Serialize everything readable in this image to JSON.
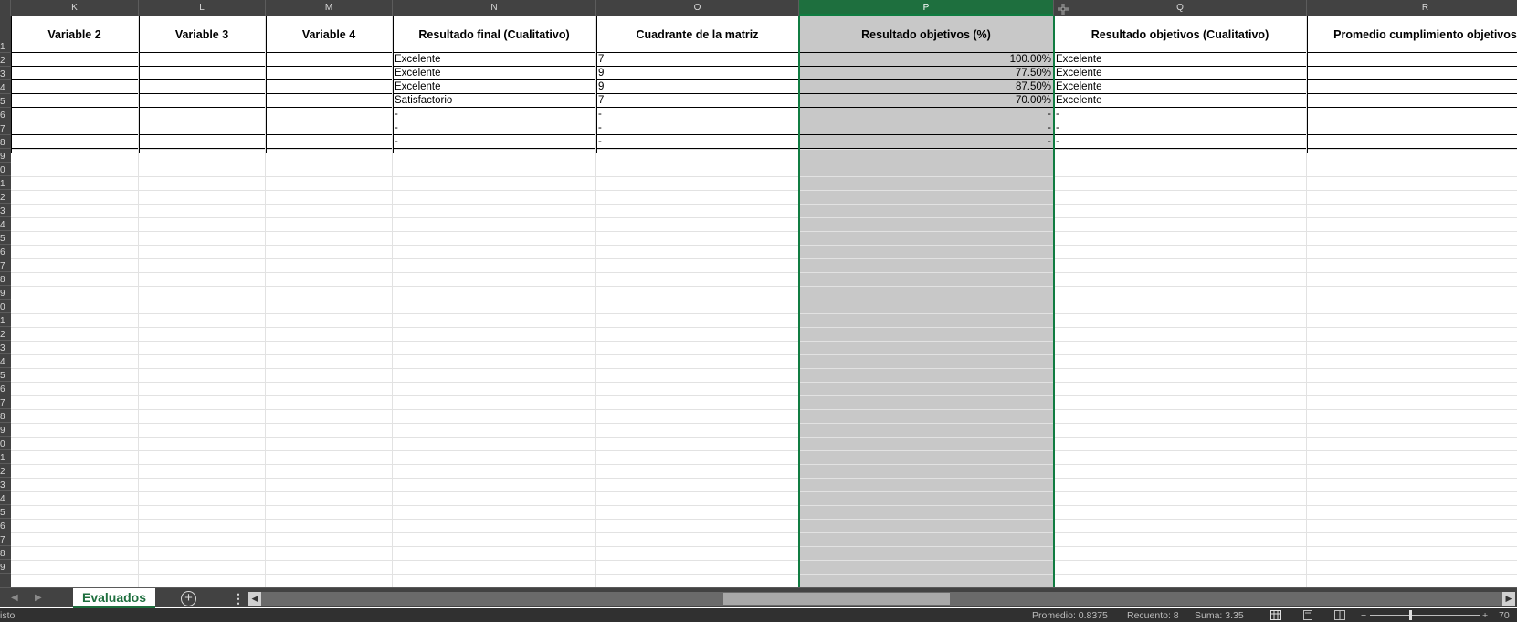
{
  "columns": [
    {
      "letter": "K",
      "header": "Variable 2",
      "selected": false
    },
    {
      "letter": "L",
      "header": "Variable 3",
      "selected": false
    },
    {
      "letter": "M",
      "header": "Variable 4",
      "selected": false
    },
    {
      "letter": "N",
      "header": "Resultado final (Cualitativo)",
      "selected": false
    },
    {
      "letter": "O",
      "header": "Cuadrante de la matriz",
      "selected": false
    },
    {
      "letter": "P",
      "header": "Resultado objetivos (%)",
      "selected": true
    },
    {
      "letter": "Q",
      "header": "Resultado objetivos (Cualitativo)",
      "selected": false
    },
    {
      "letter": "R",
      "header": "Promedio cumplimiento objetivos",
      "selected": false
    }
  ],
  "rows": [
    {
      "N": "Excelente",
      "O": "7",
      "P": "100.00%",
      "Q": "Excelente"
    },
    {
      "N": "Excelente",
      "O": "9",
      "P": "77.50%",
      "Q": "Excelente"
    },
    {
      "N": "Excelente",
      "O": "9",
      "P": "87.50%",
      "Q": "Excelente"
    },
    {
      "N": "Satisfactorio",
      "O": "7",
      "P": "70.00%",
      "Q": "Excelente"
    },
    {
      "N": "-",
      "O": "-",
      "P": "-",
      "Q": "-"
    },
    {
      "N": "-",
      "O": "-",
      "P": "-",
      "Q": "-"
    },
    {
      "N": "-",
      "O": "-",
      "P": "-",
      "Q": "-"
    }
  ],
  "row_numbers": [
    "1",
    "2",
    "3",
    "4",
    "5",
    "6",
    "7",
    "8",
    "9",
    "0",
    "1",
    "2",
    "3",
    "4",
    "5",
    "6",
    "7",
    "8",
    "9",
    "0",
    "1",
    "2",
    "3",
    "4",
    "5",
    "6",
    "7",
    "8",
    "9",
    "0",
    "1",
    "2",
    "3",
    "4",
    "5",
    "6",
    "7",
    "8",
    "9"
  ],
  "sheet_tab": "Evaluados",
  "status": {
    "ready": "isto",
    "average": "Promedio: 0.8375",
    "count": "Recuento: 8",
    "sum": "Suma: 3.35",
    "zoom": "70"
  },
  "colors": {
    "accent": "#1e6f3e",
    "selection_fill": "#c8c8c8",
    "header_bg": "#424242"
  }
}
